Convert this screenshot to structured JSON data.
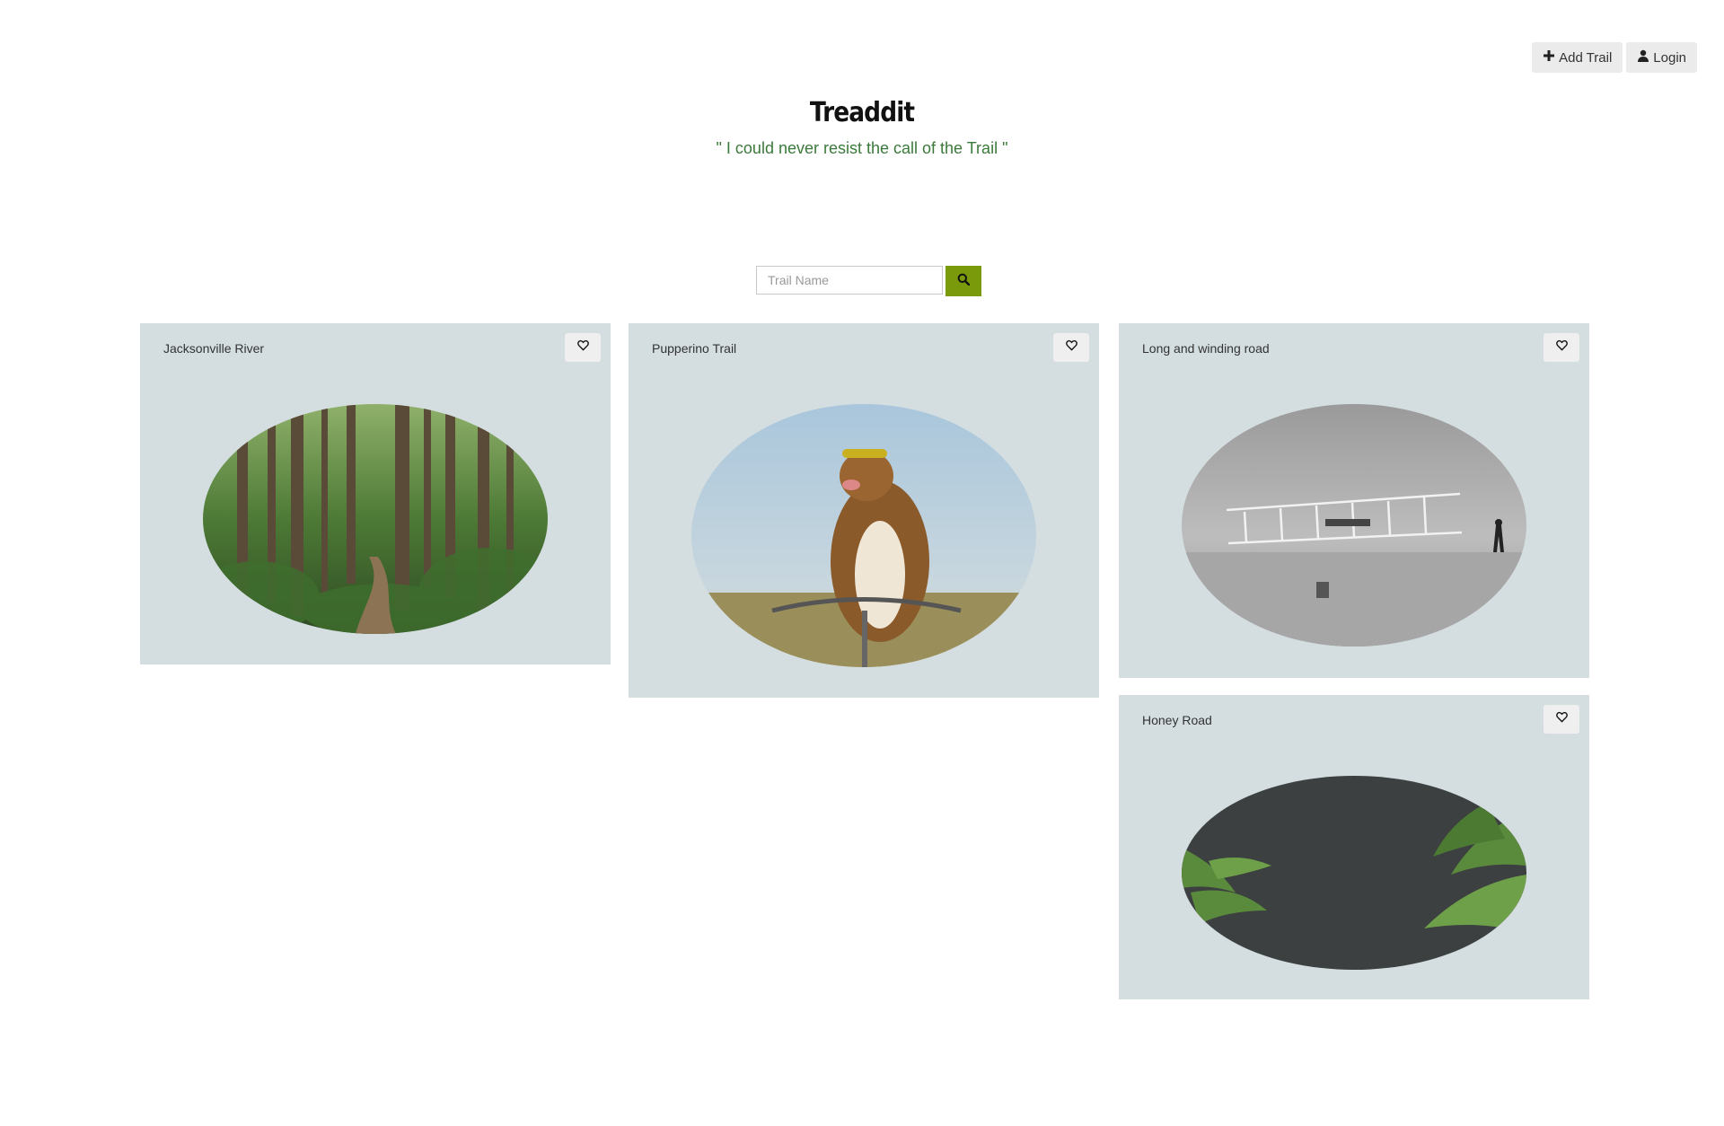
{
  "nav": {
    "add_trail_label": "Add Trail",
    "login_label": "Login"
  },
  "header": {
    "title": "Treaddit",
    "tagline": "\" I could never resist the call of the Trail \""
  },
  "search": {
    "placeholder": "Trail Name"
  },
  "colors": {
    "accent": "#7a9a0b",
    "card_bg": "#d4dee0",
    "tagline": "#3a7a3a"
  },
  "trails": [
    {
      "name": "Jacksonville River",
      "image": "forest-path"
    },
    {
      "name": "Pupperino Trail",
      "image": "dog-on-bicycle"
    },
    {
      "name": "Long and winding road",
      "image": "vintage-airplane"
    },
    {
      "name": "Honey Road",
      "image": "ferns-dark"
    }
  ]
}
